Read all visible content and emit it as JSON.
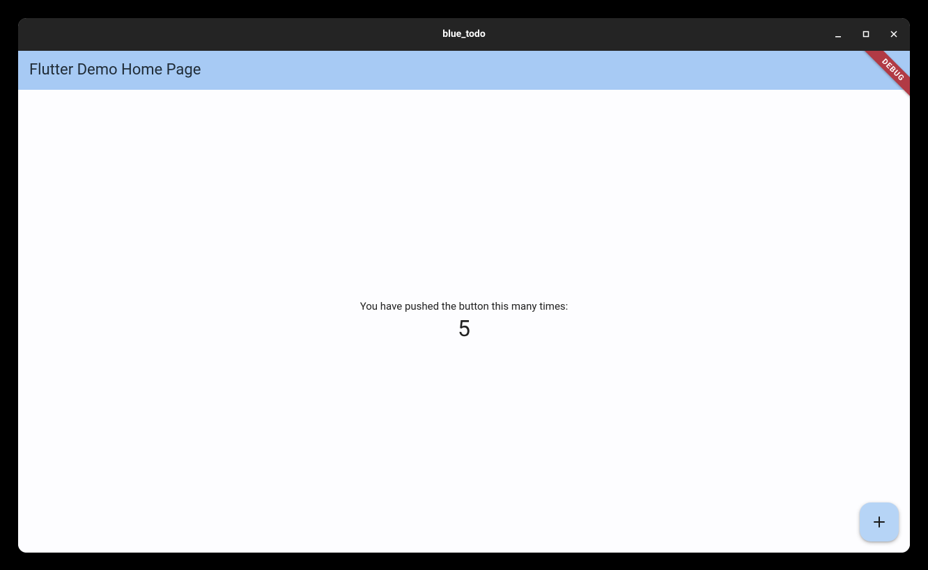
{
  "window": {
    "title": "blue_todo"
  },
  "appbar": {
    "title": "Flutter Demo Home Page"
  },
  "content": {
    "message": "You have pushed the button this many times:",
    "counter": "5"
  },
  "fab": {
    "icon": "plus-icon"
  },
  "debug_banner": {
    "label": "DEBUG"
  },
  "colors": {
    "appbar_bg": "#a7caf4",
    "fab_bg": "#b6d4f6",
    "titlebar_bg": "#242424",
    "debug_banner_bg": "#b13a45"
  }
}
